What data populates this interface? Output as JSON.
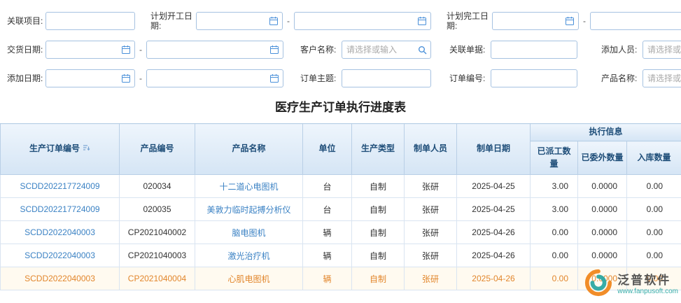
{
  "title": "医疗生产订单执行进度表",
  "filters": {
    "range_separator": "-",
    "related_project": {
      "label": "关联项目:"
    },
    "planned_start": {
      "label": "计划开工日期:"
    },
    "planned_finish": {
      "label": "计划完工日期:"
    },
    "delivery_date": {
      "label": "交货日期:"
    },
    "customer_name": {
      "label": "客户名称:",
      "placeholder": "请选择或输入"
    },
    "related_doc": {
      "label": "关联单据:"
    },
    "add_person": {
      "label": "添加人员:",
      "placeholder": "请选择或输入"
    },
    "add_date": {
      "label": "添加日期:"
    },
    "order_subject": {
      "label": "订单主题:"
    },
    "order_no": {
      "label": "订单编号:"
    },
    "product_name": {
      "label": "产品名称:",
      "placeholder": "请选择或输入"
    }
  },
  "table": {
    "columns": {
      "order_no": "生产订单编号",
      "product_no": "产品编号",
      "product_name": "产品名称",
      "unit": "单位",
      "prod_type": "生产类型",
      "maker": "制单人员",
      "make_date": "制单日期",
      "exec_group": "执行信息",
      "dispatched": "已派工数量",
      "outsourced": "已委外数量",
      "inbound": "入库数量"
    },
    "rows": [
      {
        "order_no": "SCDD202217724009",
        "product_no": "020034",
        "product_name": "十二道心电图机",
        "unit": "台",
        "prod_type": "自制",
        "maker": "张研",
        "make_date": "2025-04-25",
        "dispatched": "3.00",
        "outsourced": "0.0000",
        "inbound": "0.00",
        "highlight": false
      },
      {
        "order_no": "SCDD202217724009",
        "product_no": "020035",
        "product_name": "美敦力临时起搏分析仪",
        "unit": "台",
        "prod_type": "自制",
        "maker": "张研",
        "make_date": "2025-04-25",
        "dispatched": "3.00",
        "outsourced": "0.0000",
        "inbound": "0.00",
        "highlight": false
      },
      {
        "order_no": "SCDD2022040003",
        "product_no": "CP2021040002",
        "product_name": "脑电图机",
        "unit": "辆",
        "prod_type": "自制",
        "maker": "张研",
        "make_date": "2025-04-26",
        "dispatched": "0.00",
        "outsourced": "0.0000",
        "inbound": "0.00",
        "highlight": false
      },
      {
        "order_no": "SCDD2022040003",
        "product_no": "CP2021040003",
        "product_name": "激光治疗机",
        "unit": "辆",
        "prod_type": "自制",
        "maker": "张研",
        "make_date": "2025-04-26",
        "dispatched": "0.00",
        "outsourced": "0.0000",
        "inbound": "0.00",
        "highlight": false
      },
      {
        "order_no": "SCDD2022040003",
        "product_no": "CP2021040004",
        "product_name": "心肌电图机",
        "unit": "辆",
        "prod_type": "自制",
        "maker": "张研",
        "make_date": "2025-04-26",
        "dispatched": "0.00",
        "outsourced": "0.0000",
        "inbound": "0.00",
        "highlight": true
      }
    ]
  },
  "watermark": {
    "brand": "泛普软件",
    "site": "www.fanpusoft.com"
  }
}
